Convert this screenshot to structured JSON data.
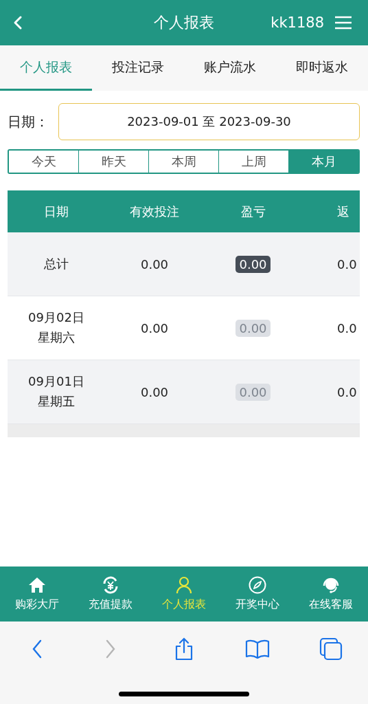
{
  "header": {
    "title": "个人报表",
    "username": "kk1188"
  },
  "tabs": [
    {
      "label": "个人报表",
      "selected": true
    },
    {
      "label": "投注记录",
      "selected": false
    },
    {
      "label": "账户流水",
      "selected": false
    },
    {
      "label": "即时返水",
      "selected": false
    }
  ],
  "date_filter": {
    "label": "日期：",
    "value": "2023-09-01 至 2023-09-30"
  },
  "quick_ranges": [
    {
      "label": "今天",
      "selected": false
    },
    {
      "label": "昨天",
      "selected": false
    },
    {
      "label": "本周",
      "selected": false
    },
    {
      "label": "上周",
      "selected": false
    },
    {
      "label": "本月",
      "selected": true
    }
  ],
  "table": {
    "columns": [
      "日期",
      "有效投注",
      "盈亏",
      "返"
    ],
    "rows": [
      {
        "date": "总计",
        "weekday": "",
        "bet": "0.00",
        "profit": "0.00",
        "profit_emphasis": true,
        "column_4": "0.0"
      },
      {
        "date": "09月02日",
        "weekday": "星期六",
        "bet": "0.00",
        "profit": "0.00",
        "profit_emphasis": false,
        "column_4": "0.0"
      },
      {
        "date": "09月01日",
        "weekday": "星期五",
        "bet": "0.00",
        "profit": "0.00",
        "profit_emphasis": false,
        "column_4": "0.0"
      }
    ]
  },
  "bottom_nav": [
    {
      "kind": "home",
      "label": "购彩大厅",
      "selected": false
    },
    {
      "kind": "exchange",
      "label": "充值提款",
      "selected": false
    },
    {
      "kind": "person",
      "label": "个人报表",
      "selected": true
    },
    {
      "kind": "compass",
      "label": "开奖中心",
      "selected": false
    },
    {
      "kind": "support",
      "label": "在线客服",
      "selected": false
    }
  ],
  "browser_toolbar": [
    {
      "kind": "back",
      "disabled": false
    },
    {
      "kind": "forward",
      "disabled": true
    },
    {
      "kind": "share",
      "disabled": false
    },
    {
      "kind": "bookmarks",
      "disabled": false
    },
    {
      "kind": "tabs",
      "disabled": false
    }
  ]
}
